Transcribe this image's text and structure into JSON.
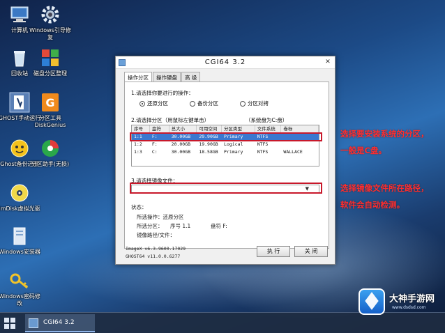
{
  "desktop": {
    "icons": [
      {
        "label": "计算机",
        "icon": "computer-icon"
      },
      {
        "label": "Windows引导修复",
        "icon": "gear-icon"
      },
      {
        "label": "回收站",
        "icon": "recycle-bin-icon"
      },
      {
        "label": "磁盘分区整理",
        "icon": "partition-tool-icon"
      },
      {
        "label": "GHOST手动运行",
        "icon": "ghost-tool-icon"
      },
      {
        "label": "分区工具DiskGenius",
        "icon": "diskgenius-icon"
      },
      {
        "label": "Ghost备份还原",
        "icon": "ghost-backup-icon"
      },
      {
        "label": "分区助手(无损)",
        "icon": "partition-assistant-icon"
      },
      {
        "label": "ImDisk虚拟光驱",
        "icon": "disc-icon"
      },
      {
        "label": "Windows安装器",
        "icon": "installer-icon"
      },
      {
        "label": "Windows密码修改",
        "icon": "key-icon"
      }
    ]
  },
  "dialog": {
    "title": "CGI64  3.2",
    "tabs": [
      "操作分区",
      "操作硬盘",
      "高  级"
    ],
    "step1_label": "1.请选择你要进行的操作：",
    "operations": [
      {
        "label": "还原分区",
        "selected": true
      },
      {
        "label": "备份分区",
        "selected": false
      },
      {
        "label": "分区对拷",
        "selected": false
      }
    ],
    "step2_label": "2.请选择分区（用鼠标左键单击）",
    "system_disk_hint": "（系统盘为C:盘）",
    "table": {
      "columns": [
        "序号",
        "盘符",
        "总大小",
        "可用空间",
        "分区类型",
        "文件系统",
        "卷标"
      ],
      "rows": [
        {
          "index": "1:1",
          "drive": "F:",
          "total": "30.00GB",
          "free": "29.90GB",
          "type": "Primary",
          "fs": "NTFS",
          "vol": "",
          "selected": true
        },
        {
          "index": "1:2",
          "drive": "F:",
          "total": "20.00GB",
          "free": "19.90GB",
          "type": "Logical",
          "fs": "NTFS",
          "vol": "",
          "selected": false
        },
        {
          "index": "1:3",
          "drive": "C:",
          "total": "30.00GB",
          "free": "18.58GB",
          "type": "Primary",
          "fs": "NTFS",
          "vol": "WALLACE",
          "selected": false
        }
      ]
    },
    "step3_label": "3.请选择镜像文件：",
    "image_file_value": "",
    "status": {
      "heading": "状态：",
      "op_label": "所选操作：还原分区",
      "part_label": "所选分区：",
      "part_index": "序号 1.1",
      "drive_label": "盘符 F:",
      "image_path_label": "镜像路径/文件："
    },
    "version_lines": [
      "ImageX v6.3.9600.17029",
      "GHOST64 v11.0.0.6277"
    ],
    "buttons": {
      "execute": "执 行",
      "close": "关 闭"
    }
  },
  "annotations": [
    {
      "line1": "选择要安装系统的分区，",
      "line2": "一般是C盘。"
    },
    {
      "line1": "选择镜像文件所在路径，",
      "line2": "软件会自动检测。"
    }
  ],
  "taskbar": {
    "active_app": "CGI64  3.2"
  },
  "watermark": {
    "name": "大神手游网",
    "url": "www.dsdsd.com"
  },
  "colors": {
    "highlight_red": "#c8182a",
    "note_red": "#ff2d2d",
    "selection_blue": "#3a78d0"
  }
}
